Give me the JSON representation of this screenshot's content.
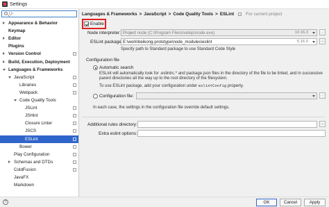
{
  "window": {
    "title": "Settings"
  },
  "sidebar": {
    "search_placeholder": "Q-",
    "items": [
      {
        "label": "Appearance & Behavior",
        "bold": true,
        "arrow": "right"
      },
      {
        "label": "Keymap",
        "bold": true
      },
      {
        "label": "Editor",
        "bold": true,
        "arrow": "right"
      },
      {
        "label": "Plugins",
        "bold": true
      },
      {
        "label": "Version Control",
        "bold": true,
        "arrow": "right",
        "project_icon": true
      },
      {
        "label": "Build, Execution, Deployment",
        "bold": true,
        "arrow": "right"
      },
      {
        "label": "Languages & Frameworks",
        "bold": true,
        "arrow": "down"
      },
      {
        "label": "JavaScript",
        "arrow": "down",
        "project_icon": true
      },
      {
        "label": "Libraries",
        "project_icon": true
      },
      {
        "label": "Webpack",
        "project_icon": true
      },
      {
        "label": "Code Quality Tools",
        "arrow": "down"
      },
      {
        "label": "JSLint",
        "project_icon": true
      },
      {
        "label": "JSHint",
        "project_icon": true
      },
      {
        "label": "Closure Linter",
        "project_icon": true
      },
      {
        "label": "JSCS",
        "project_icon": true
      },
      {
        "label": "ESLint",
        "project_icon": true,
        "selected": true
      },
      {
        "label": "Bower",
        "project_icon": true
      },
      {
        "label": "Play Configuration",
        "project_icon": true
      },
      {
        "label": "Schemas and DTDs",
        "arrow": "right",
        "project_icon": true
      },
      {
        "label": "ColdFusion",
        "project_icon": true
      },
      {
        "label": "JavaFX"
      },
      {
        "label": "Markdown"
      }
    ]
  },
  "header": {
    "crumbs": [
      "Languages & Frameworks",
      "JavaScript",
      "Code Quality Tools",
      "ESLint"
    ],
    "separator": ">",
    "scope": "For current project"
  },
  "eslint": {
    "enable_label": "Enable",
    "enabled": true,
    "node_interpreter_label": "Node interpreter:",
    "node_interpreter_prefix": "Project",
    "node_interpreter_value": "node (C:\\Program Files\\nodejs\\node.exe)",
    "node_interpreter_version": "10.16.3",
    "package_label": "ESLint package:",
    "package_value": "E:\\work\\beikong-prototype\\node_modules\\eslint",
    "package_version": "5.16.0",
    "standard_hint": "Specify path to Standard package to use Standard Code Style",
    "config_section": "Configuration file",
    "auto_search_label": "Automatic search",
    "auto_search_selected": true,
    "auto_desc_1": "ESLint will automatically look for .eslintrc.* and package.json files in the directory of the file to be linted, and in successive",
    "auto_desc_2": "parent directories all the way up to the root directory of the filesystem.",
    "auto_desc_3_prefix": "To use ESLint package, add your configuration under",
    "auto_desc_3_code": "eslintConfig",
    "auto_desc_3_suffix": "property.",
    "config_file_label": "Configuration file:",
    "config_file_value": "",
    "override_note": "In each case, the settings in the configuration file override default settings.",
    "rules_dir_label": "Additional rules directory:",
    "rules_dir_value": "",
    "extra_options_label": "Extra eslint options:",
    "extra_options_value": ""
  },
  "buttons": {
    "help": "?",
    "ok": "OK",
    "cancel": "Cancel",
    "apply": "Apply"
  }
}
